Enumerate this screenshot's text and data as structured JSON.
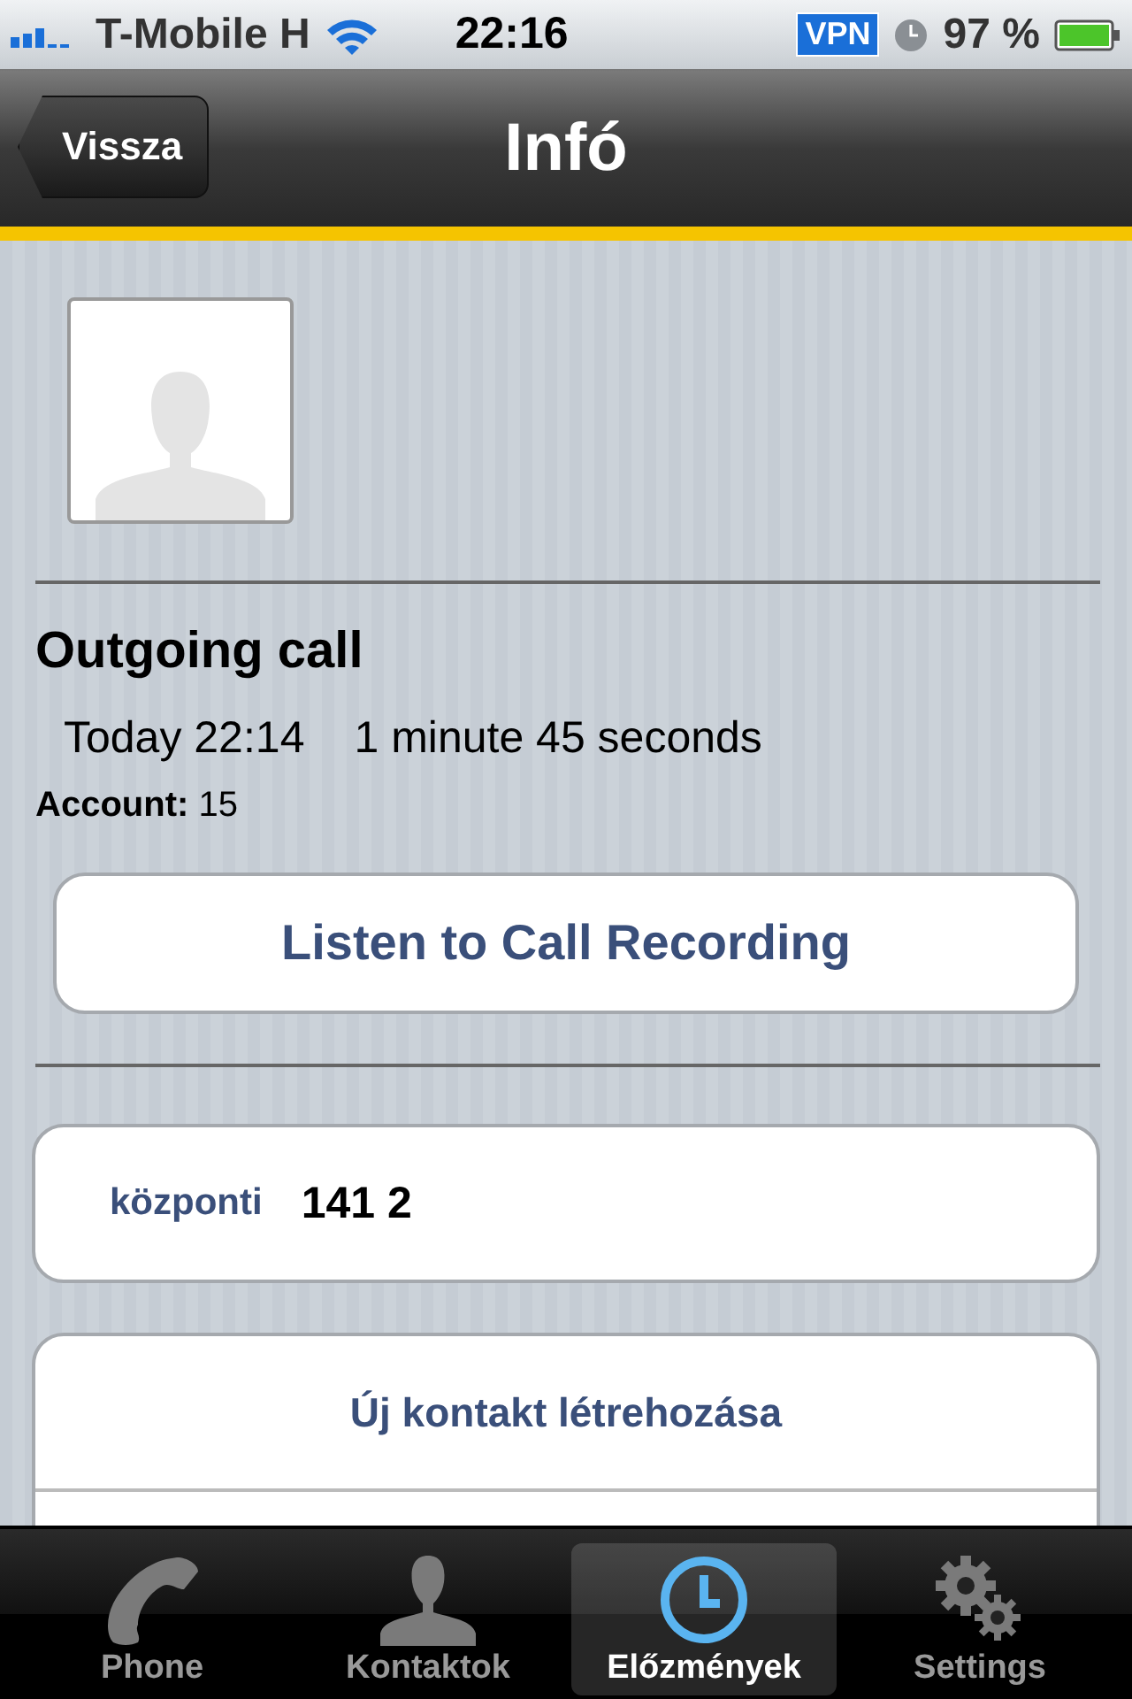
{
  "status_bar": {
    "carrier": "T-Mobile H",
    "time": "22:16",
    "vpn": "VPN",
    "battery": "97 %"
  },
  "nav_bar": {
    "back": "Vissza",
    "title": "Infó"
  },
  "call": {
    "title": "Outgoing call",
    "when": "Today 22:14",
    "duration": "1 minute 45 seconds",
    "account": "**Account:** 15"
  },
  "recording_button": "Listen to Call Recording",
  "phone": {
    "label": "központi",
    "number": "141 2"
  },
  "actions": [
    "Új kontakt létrehozása"
  ],
  "tabs": [
    {
      "label": "Phone",
      "kind": "phone",
      "selected": false
    },
    {
      "label": "Kontaktok",
      "kind": "person",
      "selected": false
    },
    {
      "label": "Előzmények",
      "kind": "clock",
      "selected": true
    },
    {
      "label": "Settings",
      "kind": "gear",
      "selected": false
    }
  ]
}
